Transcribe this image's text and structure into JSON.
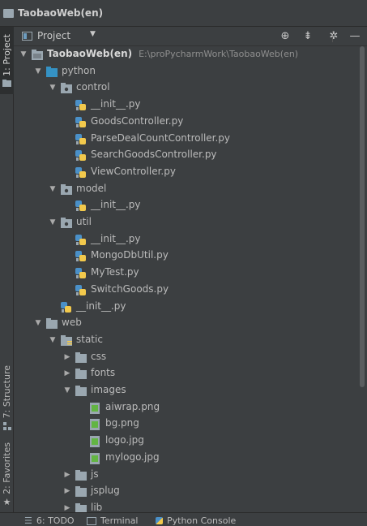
{
  "window": {
    "title": "TaobaoWeb(en)"
  },
  "left_tabs": {
    "project": "1: Project",
    "structure": "7: Structure",
    "favorites": "2: Favorites"
  },
  "panel": {
    "view_label": "Project",
    "toolbar_icons": [
      "target-icon",
      "collapse-all-icon",
      "gear-icon",
      "minimize-icon"
    ]
  },
  "tree": [
    {
      "label": "TaobaoWeb(en)",
      "path": "E:\\proPycharmWork\\TaobaoWeb(en)",
      "type": "module",
      "depth": 0,
      "arrow": "open",
      "bold": true
    },
    {
      "label": "python",
      "type": "folder-blue",
      "depth": 1,
      "arrow": "open"
    },
    {
      "label": "control",
      "type": "package",
      "depth": 2,
      "arrow": "open"
    },
    {
      "label": "__init__.py",
      "type": "py",
      "depth": 3
    },
    {
      "label": "GoodsController.py",
      "type": "py",
      "depth": 3
    },
    {
      "label": "ParseDealCountController.py",
      "type": "py",
      "depth": 3
    },
    {
      "label": "SearchGoodsController.py",
      "type": "py",
      "depth": 3
    },
    {
      "label": "ViewController.py",
      "type": "py",
      "depth": 3
    },
    {
      "label": "model",
      "type": "package",
      "depth": 2,
      "arrow": "open"
    },
    {
      "label": "__init__.py",
      "type": "py",
      "depth": 3
    },
    {
      "label": "util",
      "type": "package",
      "depth": 2,
      "arrow": "open"
    },
    {
      "label": "__init__.py",
      "type": "py",
      "depth": 3
    },
    {
      "label": "MongoDbUtil.py",
      "type": "py",
      "depth": 3
    },
    {
      "label": "MyTest.py",
      "type": "py",
      "depth": 3
    },
    {
      "label": "SwitchGoods.py",
      "type": "py",
      "depth": 3
    },
    {
      "label": "__init__.py",
      "type": "py",
      "depth": 2
    },
    {
      "label": "web",
      "type": "folder",
      "depth": 1,
      "arrow": "open"
    },
    {
      "label": "static",
      "type": "folder-res",
      "depth": 2,
      "arrow": "open"
    },
    {
      "label": "css",
      "type": "folder",
      "depth": 3,
      "arrow": "closed"
    },
    {
      "label": "fonts",
      "type": "folder",
      "depth": 3,
      "arrow": "closed"
    },
    {
      "label": "images",
      "type": "folder",
      "depth": 3,
      "arrow": "open"
    },
    {
      "label": "aiwrap.png",
      "type": "image",
      "depth": 4
    },
    {
      "label": "bg.png",
      "type": "image",
      "depth": 4
    },
    {
      "label": "logo.jpg",
      "type": "image",
      "depth": 4
    },
    {
      "label": "mylogo.jpg",
      "type": "image",
      "depth": 4
    },
    {
      "label": "js",
      "type": "folder",
      "depth": 3,
      "arrow": "closed"
    },
    {
      "label": "jsplug",
      "type": "folder",
      "depth": 3,
      "arrow": "closed"
    },
    {
      "label": "lib",
      "type": "folder",
      "depth": 3,
      "arrow": "closed"
    }
  ],
  "bottom_tabs": [
    {
      "label": "6: TODO",
      "icon": "list-icon"
    },
    {
      "label": "Terminal",
      "icon": "terminal-icon"
    },
    {
      "label": "Python Console",
      "icon": "python-icon"
    }
  ],
  "colors": {
    "background": "#3c3f41",
    "folder": "#9aa7b0",
    "folder_blue": "#3592c4",
    "python_blue": "#4a90c8",
    "python_yellow": "#f2c94c",
    "image_file": "#62b543"
  }
}
